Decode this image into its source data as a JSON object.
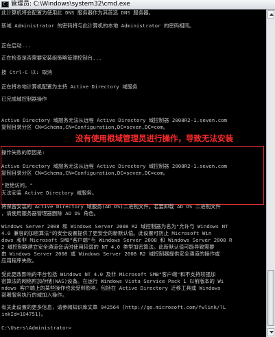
{
  "window": {
    "title": "管理员: C:\\Windows\\system32\\cmd.exe",
    "icon_text": "C:\\"
  },
  "annotation": {
    "text": "没有使用根域管理员进行操作，导致无法安装",
    "color": "#ff2a2a"
  },
  "console": {
    "lines": [
      "此计算机将会配置为使用此 DNS 服务器作为其首选 DNS 服务器。",
      "新域 Administrator 的密码将与此计算机的本地 Administrator 的密码相同。",
      "正在启动...",
      "正在检查是否需要安装组策略管理控制台...",
      "按 Ctrl-C 以: 取消",
      "正在将本地计算机配置为主持 Active Directory 域服务",
      "已完成域控制器操作",
      "Active Directory 域服务无法从远程 Active Directory 域控制器 2008R2-1.seven.com",
      "复制目录分区 CN=Schema,CN=Configuration,DC=seven,DC=com。",
      "操作失败的原因是:",
      "Active Directory 域服务无法从远程 Active Directory 域控制器 2008R2-1.seven.com",
      "复制目录分区 CN=Schema,CN=Configuration,DC=seven,DC=com。",
      "\"拒绝访问。\"",
      "无法安装 Active Directory 域服务。",
      "将保留安装的 Active Directory 域服务(AD DS)二进制文件。若要卸载 AD DS 二进制文件",
      "，请使用服务器管理器删除 AD DS 角色。",
      "Windows Server 2008 和 Windows Server 2008 R2 域控制器为名为\"允许与 Windows NT",
      "4.0 兼容的加密算法\"的安全设置提供了更安全的新默认值。此设置可防止 Microsoft Win",
      "dows 和非 Microsoft SMB\"客户端\"与 Windows Server 2008 和 Windows Server 2008 R",
      "2 域控制器建立安全通道会话时使用较弱的 NT 4.0 类型加密算法。此新默认值可能导致需要",
      "由 Windows Server 2008 或 Windows Server 2008 R2 域控制器提供安全通道的操作或",
      "应用程序失败。",
      "受此更改影响的平台包括 Windows NT 4.0 及非 Microsoft SMB\"客户端\"和不支持较强加",
      "密算法的网络附加存储(NAS)设备。在运行 Windows Vista Service Pack 1 以前版本的 Wi",
      "ndows 客户端上的某些操作也会受到影响，包括在 Active Directory 迁移工具或 Windows",
      "部署服务执行的域加入操作。",
      "有关此设置的更多信息，请参阅知识库文章 942564 (http://go.microsoft.com/fwlink/?L",
      "inkId=104751)。",
      "C:\\Users\\Administrator>"
    ]
  }
}
